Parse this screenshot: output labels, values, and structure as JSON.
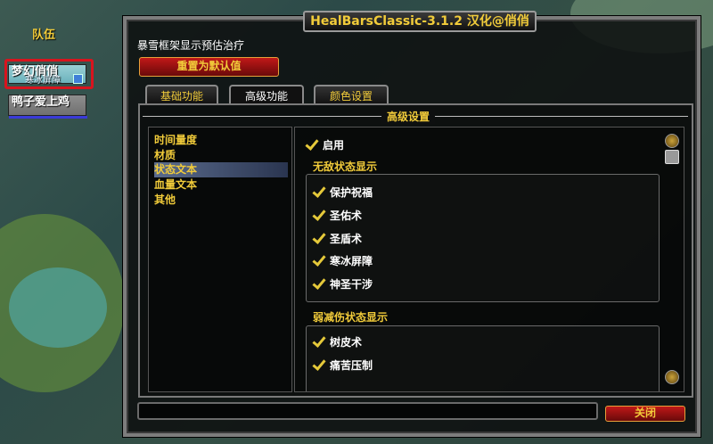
{
  "party": {
    "label": "队伍",
    "members": [
      {
        "name": "梦幻俏俏",
        "status": "寒冰屏障"
      },
      {
        "name": "鸭子爱上鸡"
      }
    ]
  },
  "dialog": {
    "title": "HealBarsClassic-3.1.2 汉化@俏俏",
    "caption": "暴雪框架显示预估治疗",
    "reset_label": "重置为默认值",
    "tabs": [
      "基础功能",
      "高级功能",
      "颜色设置"
    ],
    "active_tab": "高级功能",
    "panel_title": "高级设置",
    "categories": [
      "时间量度",
      "材质",
      "状态文本",
      "血量文本",
      "其他"
    ],
    "selected_category": "状态文本",
    "enable_label": "启用",
    "invuln_section": {
      "title": "无敌状态显示",
      "items": [
        "保护祝福",
        "圣佑术",
        "圣盾术",
        "寒冰屏障",
        "神圣干涉"
      ]
    },
    "reduction_section": {
      "title": "弱减伤状态显示",
      "items": [
        "树皮术",
        "痛苦压制"
      ]
    },
    "close_label": "关闭"
  },
  "colors": {
    "accent_gold": "#f2cc3a",
    "button_red": "#c01818",
    "highlight_red": "#d8141e"
  }
}
